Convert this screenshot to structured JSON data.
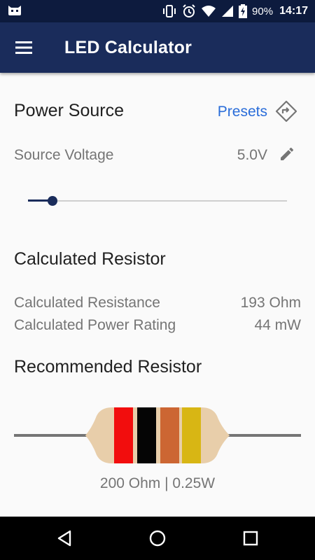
{
  "status_bar": {
    "battery_percent": "90%",
    "time": "14:17",
    "icons": [
      "notification-cat-icon",
      "vibrate-icon",
      "alarm-icon",
      "wifi-icon",
      "signal-icon",
      "battery-icon"
    ]
  },
  "app_bar": {
    "title": "LED Calculator",
    "menu_icon": "menu-icon"
  },
  "power_source": {
    "title": "Power Source",
    "presets_label": "Presets",
    "presets_icon": "presets-icon",
    "voltage_label": "Source Voltage",
    "voltage_value": "5.0V",
    "edit_icon": "pencil-icon",
    "slider_fraction": 0.095
  },
  "calculated_resistor": {
    "title": "Calculated Resistor",
    "resistance_label": "Calculated Resistance",
    "resistance_value": "193 Ohm",
    "power_label": "Calculated Power Rating",
    "power_value": "44 mW"
  },
  "recommended_resistor": {
    "title": "Recommended Resistor",
    "bands": [
      "red",
      "black",
      "brown",
      "gold"
    ],
    "band_colors": [
      "#f20d0d",
      "#050505",
      "#cc6633",
      "#d8b614"
    ],
    "body_color": "#e8ceaa",
    "caption": "200 Ohm | 0.25W"
  },
  "colors": {
    "primary": "#1a2c5b",
    "status_bar": "#0d1b3e",
    "accent_link": "#2a6dd9"
  },
  "nav_bar": {
    "buttons": [
      "back-icon",
      "home-icon",
      "recents-icon"
    ]
  }
}
